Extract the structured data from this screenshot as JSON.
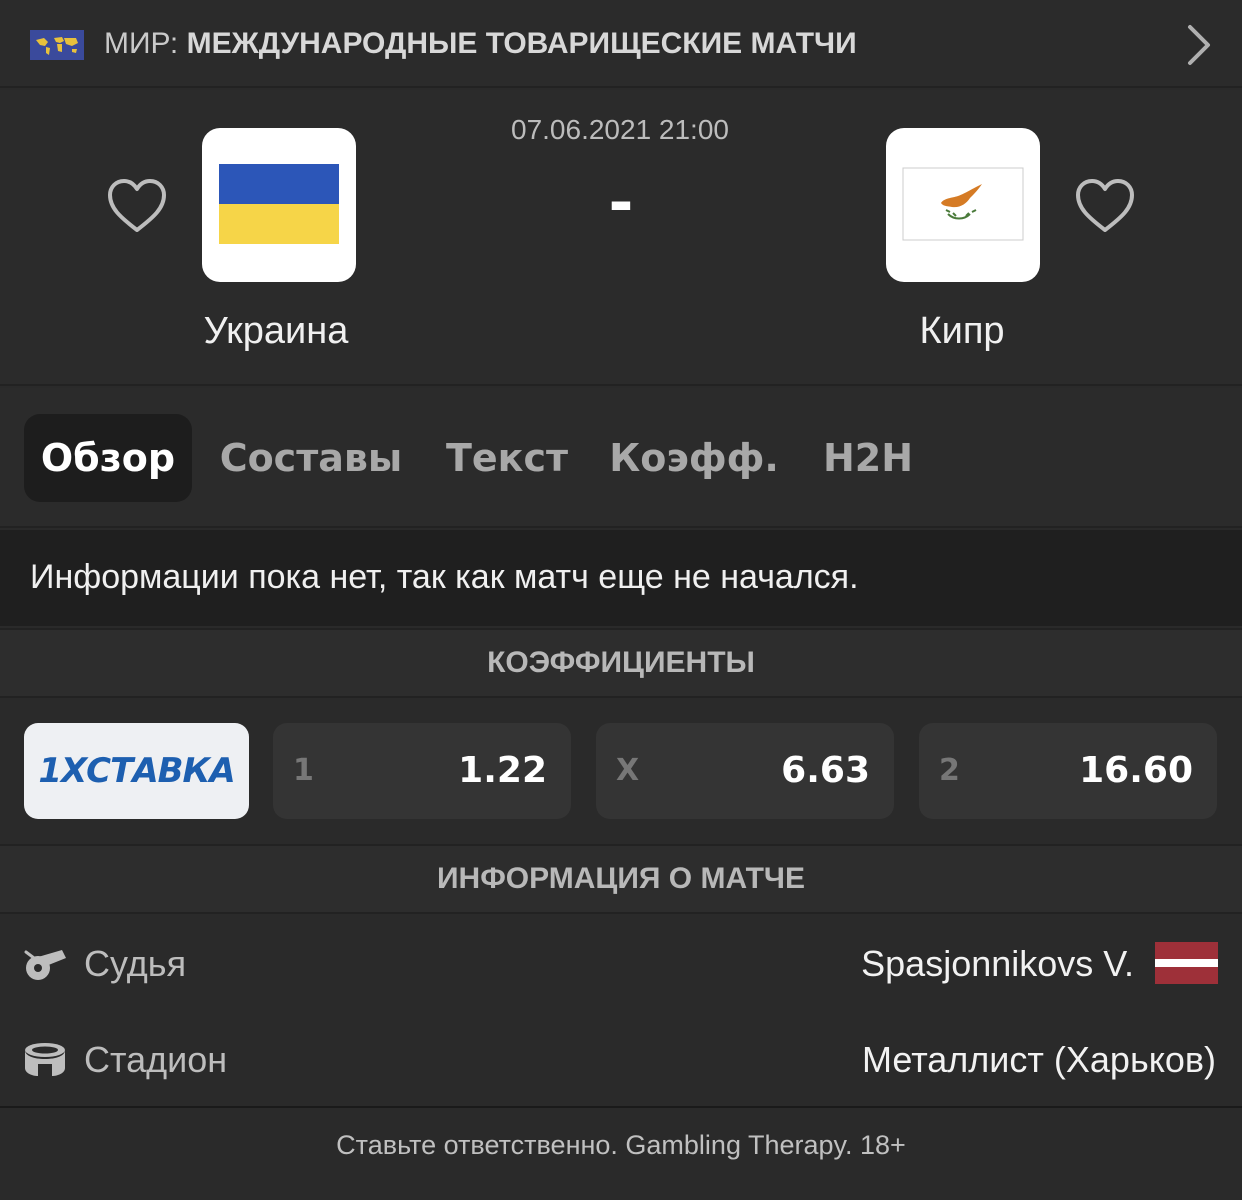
{
  "league": {
    "country": "МИР:",
    "name": "МЕЖДУНАРОДНЫЕ ТОВАРИЩЕСКИЕ МАТЧИ",
    "flag_icon": "world-map-flag"
  },
  "match": {
    "datetime": "07.06.2021 21:00",
    "score": "-",
    "home": {
      "name": "Украина",
      "flag_colors": [
        "#2c56b8",
        "#f6d548"
      ]
    },
    "away": {
      "name": "Кипр",
      "flag_colors": [
        "#ffffff",
        "#d57b25",
        "#4a7a3a"
      ]
    }
  },
  "tabs": [
    {
      "label": "Обзор",
      "active": true
    },
    {
      "label": "Составы",
      "active": false
    },
    {
      "label": "Текст",
      "active": false
    },
    {
      "label": "Коэфф.",
      "active": false
    },
    {
      "label": "H2H",
      "active": false
    }
  ],
  "info_message": "Информации пока нет, так как матч еще не начался.",
  "odds": {
    "header": "КОЭФФИЦИЕНТЫ",
    "bookmaker": "1XСТАВКА",
    "items": [
      {
        "label": "1",
        "value": "1.22"
      },
      {
        "label": "X",
        "value": "6.63"
      },
      {
        "label": "2",
        "value": "16.60"
      }
    ]
  },
  "match_info": {
    "header": "ИНФОРМАЦИЯ О МАТЧЕ",
    "referee": {
      "label": "Судья",
      "value": "Spasjonnikovs V.",
      "icon": "whistle-icon",
      "flag": "latvia"
    },
    "stadium": {
      "label": "Стадион",
      "value": "Металлист (Харьков)",
      "icon": "stadium-icon"
    }
  },
  "footer": "Ставьте ответственно. Gambling Therapy. 18+",
  "colors": {
    "background": "#2a2a2a",
    "active_tab": "#1d1d1d",
    "odd_box": "#343434",
    "bookmaker_bg": "#eef0f3",
    "bookmaker_text": "#1d5fb0",
    "latvia_red": "#9e3039"
  }
}
